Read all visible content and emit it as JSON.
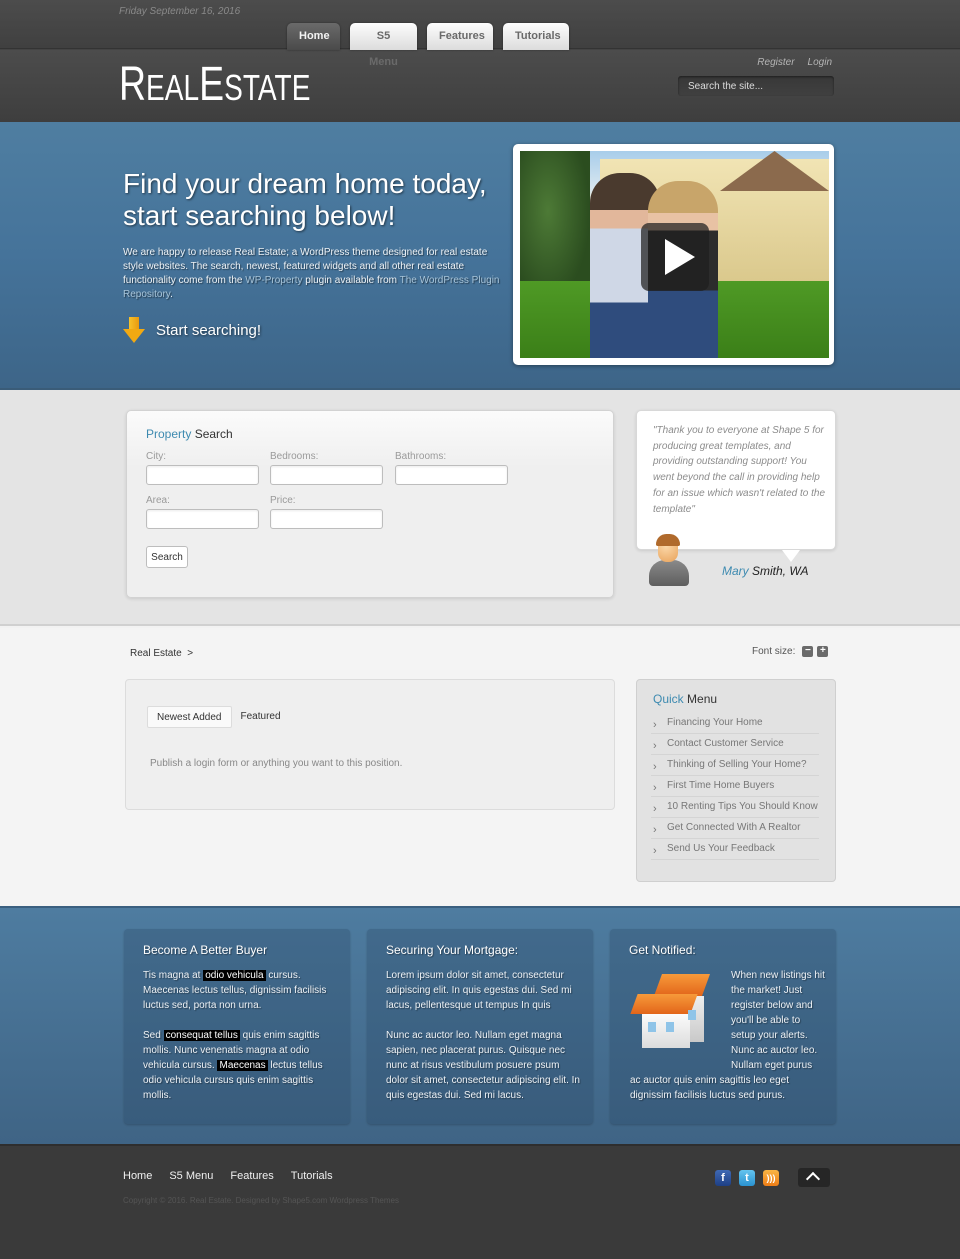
{
  "header": {
    "date": "Friday September 16, 2016",
    "nav": [
      {
        "label": "Home",
        "active": true
      },
      {
        "label": "S5 Menu",
        "active": false
      },
      {
        "label": "Features",
        "active": false
      },
      {
        "label": "Tutorials",
        "active": false
      }
    ],
    "logo": {
      "r": "R",
      "eal": "EAL",
      "e": "E",
      "state": "STATE"
    },
    "register_label": "Register",
    "login_label": "Login",
    "search_placeholder": "Search the site..."
  },
  "hero": {
    "title": "Find your dream home today, start searching below!",
    "desc_part1": "We are happy to release Real Estate; a WordPress theme designed for real estate style websites. The search, newest, featured widgets and all other real estate functionality come from the ",
    "desc_link1": "WP-Property",
    "desc_part2": " plugin available from ",
    "desc_link2": "The WordPress Plugin Repository",
    "desc_part3": ".",
    "cta_label": "Start searching!",
    "video_icon": "play-icon"
  },
  "property_search": {
    "title_highlight": "Property",
    "title_rest": " Search",
    "fields": [
      {
        "label": "City:",
        "value": ""
      },
      {
        "label": "Bedrooms:",
        "value": ""
      },
      {
        "label": "Bathrooms:",
        "value": ""
      },
      {
        "label": "Area:",
        "value": ""
      },
      {
        "label": "Price:",
        "value": ""
      }
    ],
    "button_label": "Search"
  },
  "testimonial": {
    "quote": "\"Thank you to everyone at Shape 5 for producing great templates, and providing outstanding support! You went beyond the call in providing help for an issue which wasn't related to the template\"",
    "author_first": "Mary",
    "author_rest": " Smith, WA"
  },
  "main": {
    "breadcrumb": "Real Estate",
    "breadcrumb_sep": ">",
    "font_size_label": "Font size:",
    "font_decrease": "−",
    "font_increase": "+",
    "tabs": [
      {
        "label": "Newest Added",
        "active": true
      },
      {
        "label": "Featured",
        "active": false
      }
    ],
    "tab_message": "Publish a login form or anything you want to this position."
  },
  "quick_menu": {
    "title_highlight": "Quick",
    "title_rest": " Menu",
    "items": [
      "Financing Your Home",
      "Contact Customer Service",
      "Thinking of Selling Your Home?",
      "First Time Home Buyers",
      "10 Renting Tips You Should Know",
      "Get Connected With A Realtor",
      "Send Us Your Feedback"
    ]
  },
  "bottom": {
    "col1": {
      "title": "Become A Better Buyer",
      "p1_a": "Tis magna at ",
      "p1_mark": "odio vehicula",
      "p1_b": " cursus. Maecenas lectus tellus, dignissim facilisis luctus sed, porta non urna.",
      "p2_a": "Sed ",
      "p2_mark1": "consequat tellus",
      "p2_b": " quis enim sagittis mollis. Nunc venenatis magna at odio vehicula cursus. ",
      "p2_mark2": "Maecenas",
      "p2_c": " lectus tellus odio vehicula cursus quis enim sagittis mollis."
    },
    "col2": {
      "title": "Securing Your Mortgage:",
      "p1": "Lorem ipsum dolor sit amet, consectetur adipiscing elit. In quis egestas dui. Sed mi lacus, pellentesque ut tempus   In quis",
      "p2": "Nunc ac auctor leo. Nullam eget magna sapien, nec placerat purus. Quisque nec nunc at risus vestibulum posuere psum dolor sit amet, consectetur adipiscing elit. In quis egestas dui. Sed mi lacus."
    },
    "col3": {
      "title": "Get Notified:",
      "text": "When new listings hit the market! Just register below and you'll be able to setup your alerts. Nunc ac auctor leo. Nullam eget purus ac auctor quis enim sagittis leo eget dignissim facilisis luctus sed purus."
    }
  },
  "footer": {
    "nav": [
      "Home",
      "S5 Menu",
      "Features",
      "Tutorials"
    ],
    "copyright": "Copyright © 2016. Real Estate. Designed by Shape5.com Wordpress Themes",
    "social": {
      "facebook": "f",
      "twitter": "t",
      "rss": ")))"
    }
  }
}
